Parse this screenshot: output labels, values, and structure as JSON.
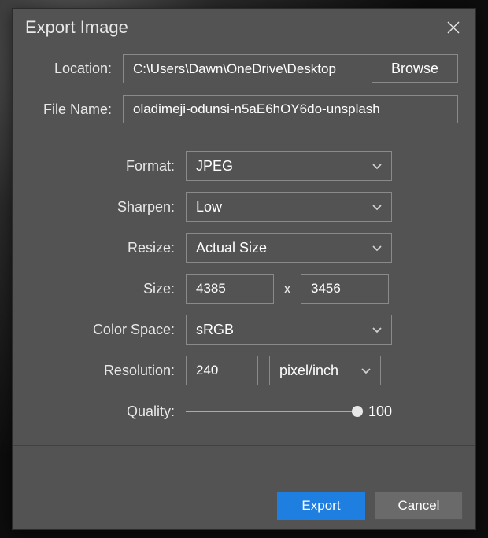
{
  "dialog": {
    "title": "Export Image",
    "close_icon": "close-icon"
  },
  "top": {
    "location_label": "Location:",
    "location_value": "C:\\Users\\Dawn\\OneDrive\\Desktop",
    "browse_label": "Browse",
    "filename_label": "File Name:",
    "filename_value": "oladimeji-odunsi-n5aE6hOY6do-unsplash"
  },
  "mid": {
    "format_label": "Format:",
    "format_value": "JPEG",
    "sharpen_label": "Sharpen:",
    "sharpen_value": "Low",
    "resize_label": "Resize:",
    "resize_value": "Actual Size",
    "size_label": "Size:",
    "size_w": "4385",
    "size_x": "x",
    "size_h": "3456",
    "colorspace_label": "Color Space:",
    "colorspace_value": "sRGB",
    "resolution_label": "Resolution:",
    "resolution_value": "240",
    "resolution_unit": "pixel/inch",
    "quality_label": "Quality:",
    "quality_value": "100"
  },
  "footer": {
    "export_label": "Export",
    "cancel_label": "Cancel"
  },
  "colors": {
    "accent": "#1f7fe0",
    "slider": "#f0a030"
  }
}
